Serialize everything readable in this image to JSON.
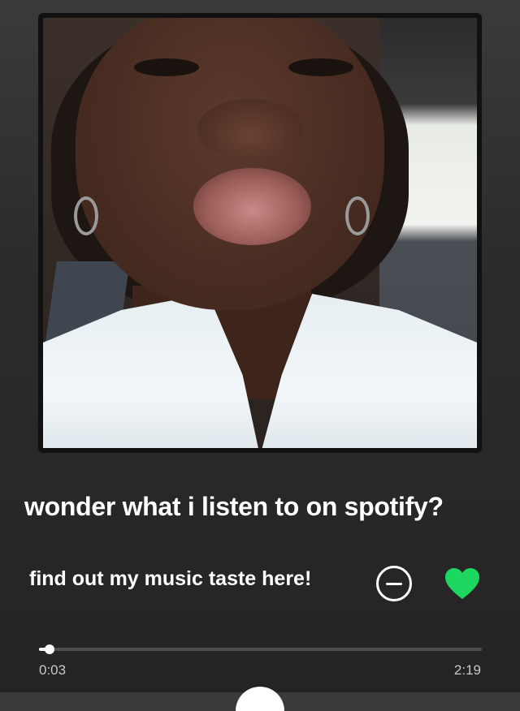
{
  "track": {
    "title": "wonder what i listen to on spotify?",
    "artist": "find out my music taste here!"
  },
  "player": {
    "elapsed": "0:03",
    "total": "2:19",
    "progress": 0.023,
    "liked": true
  },
  "icons": {
    "remove": "minus-circle-icon",
    "like": "heart-icon",
    "play": "play-button"
  },
  "colors": {
    "accent": "#1ED760",
    "background": "#2b2b2b",
    "text": "#ffffff",
    "muted": "#c8c8c8"
  }
}
